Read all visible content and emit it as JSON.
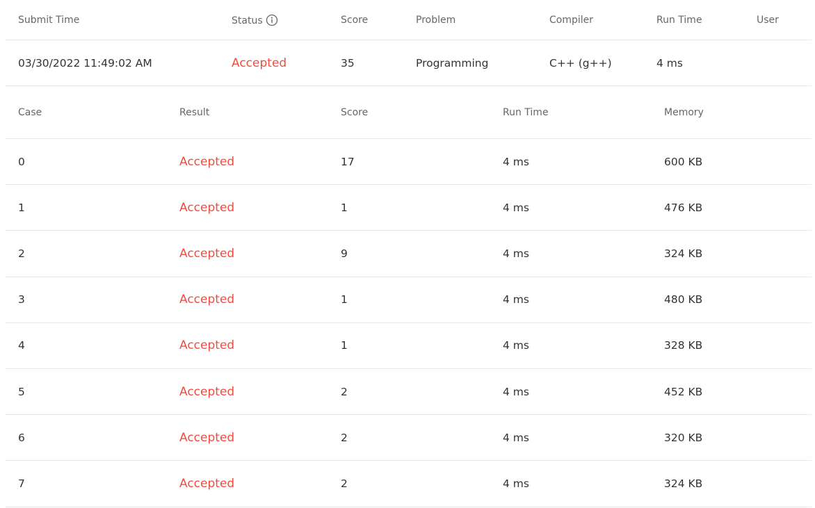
{
  "submission": {
    "headers": {
      "submit_time": "Submit Time",
      "status": "Status",
      "score": "Score",
      "problem": "Problem",
      "compiler": "Compiler",
      "run_time": "Run Time",
      "user": "User"
    },
    "status_icon": "info-circle-icon",
    "row": {
      "submit_time": "03/30/2022 11:49:02 AM",
      "status": "Accepted",
      "score": "35",
      "problem": "Programming",
      "compiler": "C++ (g++)",
      "run_time": "4 ms",
      "user": ""
    }
  },
  "cases": {
    "headers": {
      "case": "Case",
      "result": "Result",
      "score": "Score",
      "run_time": "Run Time",
      "memory": "Memory"
    },
    "rows": [
      {
        "case": "0",
        "result": "Accepted",
        "score": "17",
        "run_time": "4 ms",
        "memory": "600 KB"
      },
      {
        "case": "1",
        "result": "Accepted",
        "score": "1",
        "run_time": "4 ms",
        "memory": "476 KB"
      },
      {
        "case": "2",
        "result": "Accepted",
        "score": "9",
        "run_time": "4 ms",
        "memory": "324 KB"
      },
      {
        "case": "3",
        "result": "Accepted",
        "score": "1",
        "run_time": "4 ms",
        "memory": "480 KB"
      },
      {
        "case": "4",
        "result": "Accepted",
        "score": "1",
        "run_time": "4 ms",
        "memory": "328 KB"
      },
      {
        "case": "5",
        "result": "Accepted",
        "score": "2",
        "run_time": "4 ms",
        "memory": "452 KB"
      },
      {
        "case": "6",
        "result": "Accepted",
        "score": "2",
        "run_time": "4 ms",
        "memory": "320 KB"
      },
      {
        "case": "7",
        "result": "Accepted",
        "score": "2",
        "run_time": "4 ms",
        "memory": "324 KB"
      }
    ]
  },
  "colors": {
    "accepted": "#f24b3f",
    "header_text": "#666666",
    "body_text": "#333333",
    "divider": "#e8e8e8"
  }
}
